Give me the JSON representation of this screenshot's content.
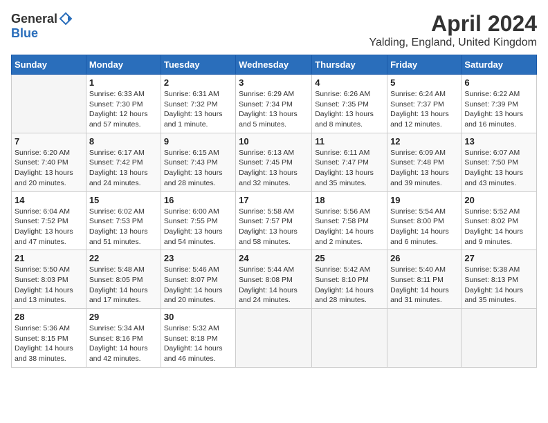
{
  "header": {
    "logo_general": "General",
    "logo_blue": "Blue",
    "month": "April 2024",
    "location": "Yalding, England, United Kingdom"
  },
  "weekdays": [
    "Sunday",
    "Monday",
    "Tuesday",
    "Wednesday",
    "Thursday",
    "Friday",
    "Saturday"
  ],
  "rows": [
    [
      {
        "day": "",
        "info": ""
      },
      {
        "day": "1",
        "info": "Sunrise: 6:33 AM\nSunset: 7:30 PM\nDaylight: 12 hours\nand 57 minutes."
      },
      {
        "day": "2",
        "info": "Sunrise: 6:31 AM\nSunset: 7:32 PM\nDaylight: 13 hours\nand 1 minute."
      },
      {
        "day": "3",
        "info": "Sunrise: 6:29 AM\nSunset: 7:34 PM\nDaylight: 13 hours\nand 5 minutes."
      },
      {
        "day": "4",
        "info": "Sunrise: 6:26 AM\nSunset: 7:35 PM\nDaylight: 13 hours\nand 8 minutes."
      },
      {
        "day": "5",
        "info": "Sunrise: 6:24 AM\nSunset: 7:37 PM\nDaylight: 13 hours\nand 12 minutes."
      },
      {
        "day": "6",
        "info": "Sunrise: 6:22 AM\nSunset: 7:39 PM\nDaylight: 13 hours\nand 16 minutes."
      }
    ],
    [
      {
        "day": "7",
        "info": "Sunrise: 6:20 AM\nSunset: 7:40 PM\nDaylight: 13 hours\nand 20 minutes."
      },
      {
        "day": "8",
        "info": "Sunrise: 6:17 AM\nSunset: 7:42 PM\nDaylight: 13 hours\nand 24 minutes."
      },
      {
        "day": "9",
        "info": "Sunrise: 6:15 AM\nSunset: 7:43 PM\nDaylight: 13 hours\nand 28 minutes."
      },
      {
        "day": "10",
        "info": "Sunrise: 6:13 AM\nSunset: 7:45 PM\nDaylight: 13 hours\nand 32 minutes."
      },
      {
        "day": "11",
        "info": "Sunrise: 6:11 AM\nSunset: 7:47 PM\nDaylight: 13 hours\nand 35 minutes."
      },
      {
        "day": "12",
        "info": "Sunrise: 6:09 AM\nSunset: 7:48 PM\nDaylight: 13 hours\nand 39 minutes."
      },
      {
        "day": "13",
        "info": "Sunrise: 6:07 AM\nSunset: 7:50 PM\nDaylight: 13 hours\nand 43 minutes."
      }
    ],
    [
      {
        "day": "14",
        "info": "Sunrise: 6:04 AM\nSunset: 7:52 PM\nDaylight: 13 hours\nand 47 minutes."
      },
      {
        "day": "15",
        "info": "Sunrise: 6:02 AM\nSunset: 7:53 PM\nDaylight: 13 hours\nand 51 minutes."
      },
      {
        "day": "16",
        "info": "Sunrise: 6:00 AM\nSunset: 7:55 PM\nDaylight: 13 hours\nand 54 minutes."
      },
      {
        "day": "17",
        "info": "Sunrise: 5:58 AM\nSunset: 7:57 PM\nDaylight: 13 hours\nand 58 minutes."
      },
      {
        "day": "18",
        "info": "Sunrise: 5:56 AM\nSunset: 7:58 PM\nDaylight: 14 hours\nand 2 minutes."
      },
      {
        "day": "19",
        "info": "Sunrise: 5:54 AM\nSunset: 8:00 PM\nDaylight: 14 hours\nand 6 minutes."
      },
      {
        "day": "20",
        "info": "Sunrise: 5:52 AM\nSunset: 8:02 PM\nDaylight: 14 hours\nand 9 minutes."
      }
    ],
    [
      {
        "day": "21",
        "info": "Sunrise: 5:50 AM\nSunset: 8:03 PM\nDaylight: 14 hours\nand 13 minutes."
      },
      {
        "day": "22",
        "info": "Sunrise: 5:48 AM\nSunset: 8:05 PM\nDaylight: 14 hours\nand 17 minutes."
      },
      {
        "day": "23",
        "info": "Sunrise: 5:46 AM\nSunset: 8:07 PM\nDaylight: 14 hours\nand 20 minutes."
      },
      {
        "day": "24",
        "info": "Sunrise: 5:44 AM\nSunset: 8:08 PM\nDaylight: 14 hours\nand 24 minutes."
      },
      {
        "day": "25",
        "info": "Sunrise: 5:42 AM\nSunset: 8:10 PM\nDaylight: 14 hours\nand 28 minutes."
      },
      {
        "day": "26",
        "info": "Sunrise: 5:40 AM\nSunset: 8:11 PM\nDaylight: 14 hours\nand 31 minutes."
      },
      {
        "day": "27",
        "info": "Sunrise: 5:38 AM\nSunset: 8:13 PM\nDaylight: 14 hours\nand 35 minutes."
      }
    ],
    [
      {
        "day": "28",
        "info": "Sunrise: 5:36 AM\nSunset: 8:15 PM\nDaylight: 14 hours\nand 38 minutes."
      },
      {
        "day": "29",
        "info": "Sunrise: 5:34 AM\nSunset: 8:16 PM\nDaylight: 14 hours\nand 42 minutes."
      },
      {
        "day": "30",
        "info": "Sunrise: 5:32 AM\nSunset: 8:18 PM\nDaylight: 14 hours\nand 46 minutes."
      },
      {
        "day": "",
        "info": ""
      },
      {
        "day": "",
        "info": ""
      },
      {
        "day": "",
        "info": ""
      },
      {
        "day": "",
        "info": ""
      }
    ]
  ]
}
